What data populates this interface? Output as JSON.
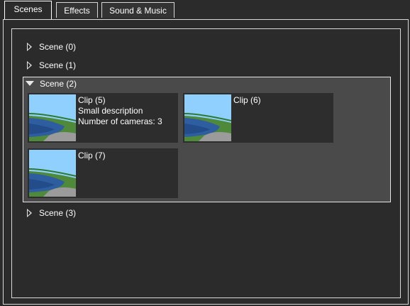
{
  "tabs": [
    {
      "label": "Scenes",
      "active": true
    },
    {
      "label": "Effects",
      "active": false
    },
    {
      "label": "Sound & Music",
      "active": false
    }
  ],
  "scenes": [
    {
      "label": "Scene (0)",
      "expanded": false
    },
    {
      "label": "Scene (1)",
      "expanded": false
    },
    {
      "label": "Scene (2)",
      "expanded": true,
      "clips": [
        {
          "title": "Clip (5)",
          "description": "Small description",
          "cameras": "Number of cameras: 3"
        },
        {
          "title": "Clip (6)"
        },
        {
          "title": "Clip (7)"
        }
      ]
    },
    {
      "label": "Scene (3)",
      "expanded": false
    }
  ],
  "icons": {
    "collapsed": "triangle-right-icon",
    "expanded": "triangle-down-icon",
    "thumbnail": "landscape-thumbnail"
  },
  "colors": {
    "background": "#2b2b2b",
    "expanded_bg": "#4a4a4a",
    "card_bg": "#2d2d2d",
    "border": "#d9d9d9",
    "sky": "#8fd0ff",
    "water": "#2e5ea0",
    "grass": "#4f8a3a"
  }
}
